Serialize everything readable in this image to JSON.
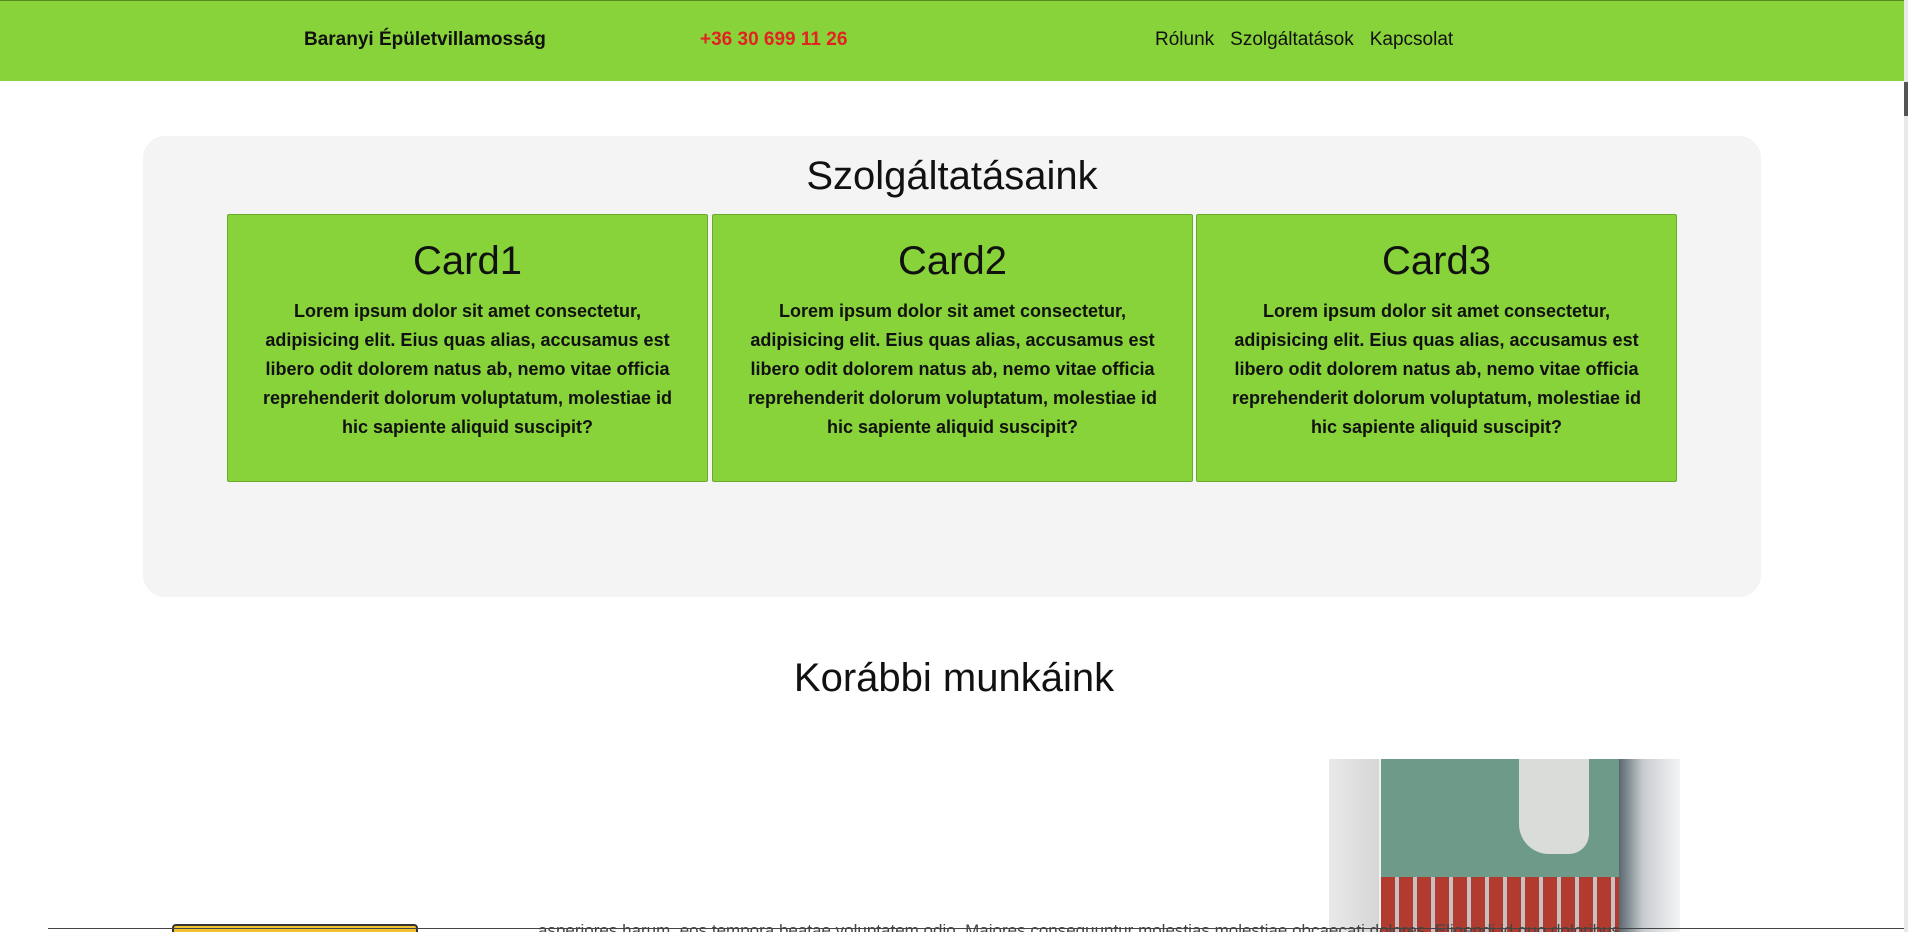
{
  "header": {
    "brand": "Baranyi Épületvillamosság",
    "phone": "+36 30 699 11 26",
    "nav": [
      "Rólunk",
      "Szolgáltatások",
      "Kapcsolat"
    ]
  },
  "services": {
    "title": "Szolgáltatásaink",
    "cards": [
      {
        "title": "Card1",
        "text": "Lorem ipsum dolor sit amet consectetur, adipisicing elit. Eius quas alias, accusamus est libero odit dolorem natus ab, nemo vitae officia reprehenderit dolorum voluptatum, molestiae id hic sapiente aliquid suscipit?"
      },
      {
        "title": "Card2",
        "text": "Lorem ipsum dolor sit amet consectetur, adipisicing elit. Eius quas alias, accusamus est libero odit dolorem natus ab, nemo vitae officia reprehenderit dolorum voluptatum, molestiae id hic sapiente aliquid suscipit?"
      },
      {
        "title": "Card3",
        "text": "Lorem ipsum dolor sit amet consectetur, adipisicing elit. Eius quas alias, accusamus est libero odit dolorem natus ab, nemo vitae officia reprehenderit dolorum voluptatum, molestiae id hic sapiente aliquid suscipit?"
      }
    ]
  },
  "previous_works": {
    "title": "Korábbi munkáink",
    "partial_text": "asperiores harum, eos tempora beatae voluptatem odio. Maiores consequuntur molestias molestiae obcaecati dolores. Eligendi id quo doloribus"
  },
  "colors": {
    "accent_green": "#87d339",
    "phone_red": "#e32222",
    "panel_gray": "#f4f4f4"
  }
}
